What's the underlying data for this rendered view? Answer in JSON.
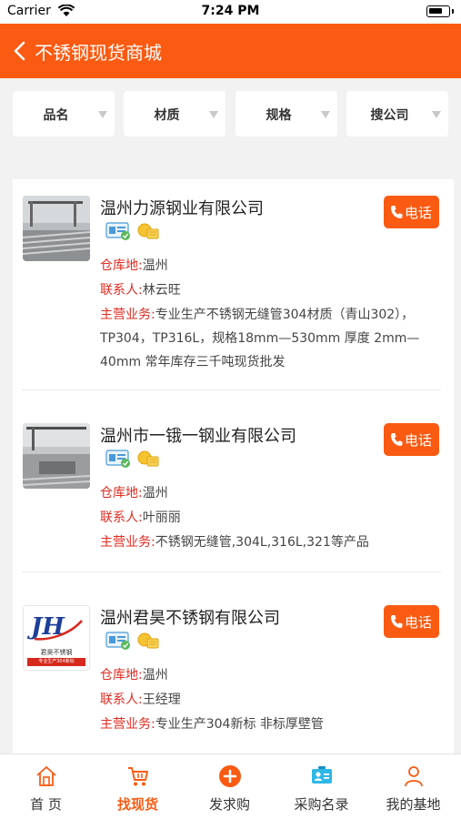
{
  "status_bar": {
    "carrier": "Carrier",
    "time": "7:24 PM"
  },
  "nav": {
    "title": "不锈钢现货商城",
    "back_icon": "chevron-left-icon"
  },
  "filters": [
    {
      "label": "品名"
    },
    {
      "label": "材质"
    },
    {
      "label": "规格"
    },
    {
      "label": "搜公司"
    }
  ],
  "labels": {
    "warehouse": "仓库地:",
    "contact": "联系人:",
    "business": "主营业务:",
    "call": "电话"
  },
  "companies": [
    {
      "name": "温州力源钢业有限公司",
      "warehouse": "温州",
      "contact": "林云旺",
      "business": "专业生产不锈钢无缝管304材质（青山302），TP304，TP316L，规格18mm—530mm 厚度 2mm—40mm 常年库存三千吨现货批发"
    },
    {
      "name": "温州市一锇一钢业有限公司",
      "warehouse": "温州",
      "contact": "叶丽丽",
      "business": "不锈钢无缝管,304L,316L,321等产品"
    },
    {
      "name": "温州君昊不锈钢有限公司",
      "warehouse": "温州",
      "contact": "王经理",
      "business": "专业生产304新标 非标厚壁管",
      "logo_text": "JH",
      "logo_caption": "君昊不锈钢",
      "logo_strip": "专业生产304新标"
    }
  ],
  "tabs": [
    {
      "label": "首 页",
      "icon": "home-icon",
      "active": false
    },
    {
      "label": "找现货",
      "icon": "cart-icon",
      "active": true
    },
    {
      "label": "发求购",
      "icon": "plus-circle-icon",
      "active": false
    },
    {
      "label": "采购名录",
      "icon": "contact-card-icon",
      "active": false
    },
    {
      "label": "我的基地",
      "icon": "user-icon",
      "active": false
    }
  ],
  "colors": {
    "brand": "#fb5a12",
    "key_text": "#e02b20"
  }
}
